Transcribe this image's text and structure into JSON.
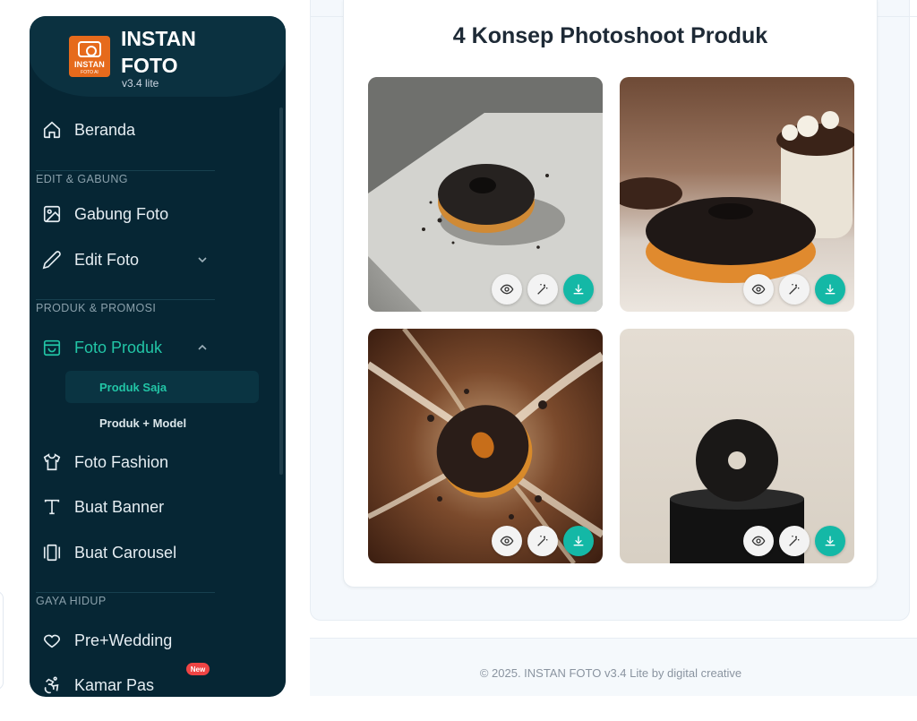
{
  "brand": {
    "name": "INSTAN FOTO",
    "version": "v3.4 lite",
    "logo_text": "INSTAN",
    "logo_sub": "FOTO AI"
  },
  "sidebar": {
    "home": "Beranda",
    "sections": [
      {
        "label": "EDIT & GABUNG",
        "items": [
          "Gabung Foto",
          "Edit Foto"
        ]
      },
      {
        "label": "PRODUK & PROMOSI",
        "items": [
          "Foto Produk",
          "Foto Fashion",
          "Buat Banner",
          "Buat Carousel"
        ]
      },
      {
        "label": "GAYA HIDUP",
        "items": [
          "Pre+Wedding",
          "Kamar Pas"
        ]
      }
    ],
    "sub_items": [
      "Produk Saja",
      "Produk + Model"
    ],
    "active_item": "Foto Produk",
    "active_sub_item": "Produk Saja",
    "new_badge": "New"
  },
  "main": {
    "title": "4 Konsep Photoshoot Produk",
    "photos": [
      {
        "alt": "Donat cokelat di atas kertas dengan bayangan",
        "actions": [
          "eye-icon",
          "magic-wand-icon",
          "download-icon"
        ]
      },
      {
        "alt": "Donat cokelat di meja marmer dengan latar kafe",
        "actions": [
          "eye-icon",
          "magic-wand-icon",
          "download-icon"
        ]
      },
      {
        "alt": "Donat cokelat meledak dengan percikan cokelat",
        "actions": [
          "eye-icon",
          "magic-wand-icon",
          "download-icon"
        ]
      },
      {
        "alt": "Donat cokelat di atas podium hitam",
        "actions": [
          "eye-icon",
          "magic-wand-icon",
          "download-icon"
        ]
      }
    ]
  },
  "footer": {
    "text": "© 2025. INSTAN FOTO v3.4 Lite by digital creative"
  },
  "colors": {
    "sidebar_bg": "#062634",
    "accent": "#22c5a6",
    "download_button": "#14b8a6",
    "badge": "#ef4444"
  }
}
